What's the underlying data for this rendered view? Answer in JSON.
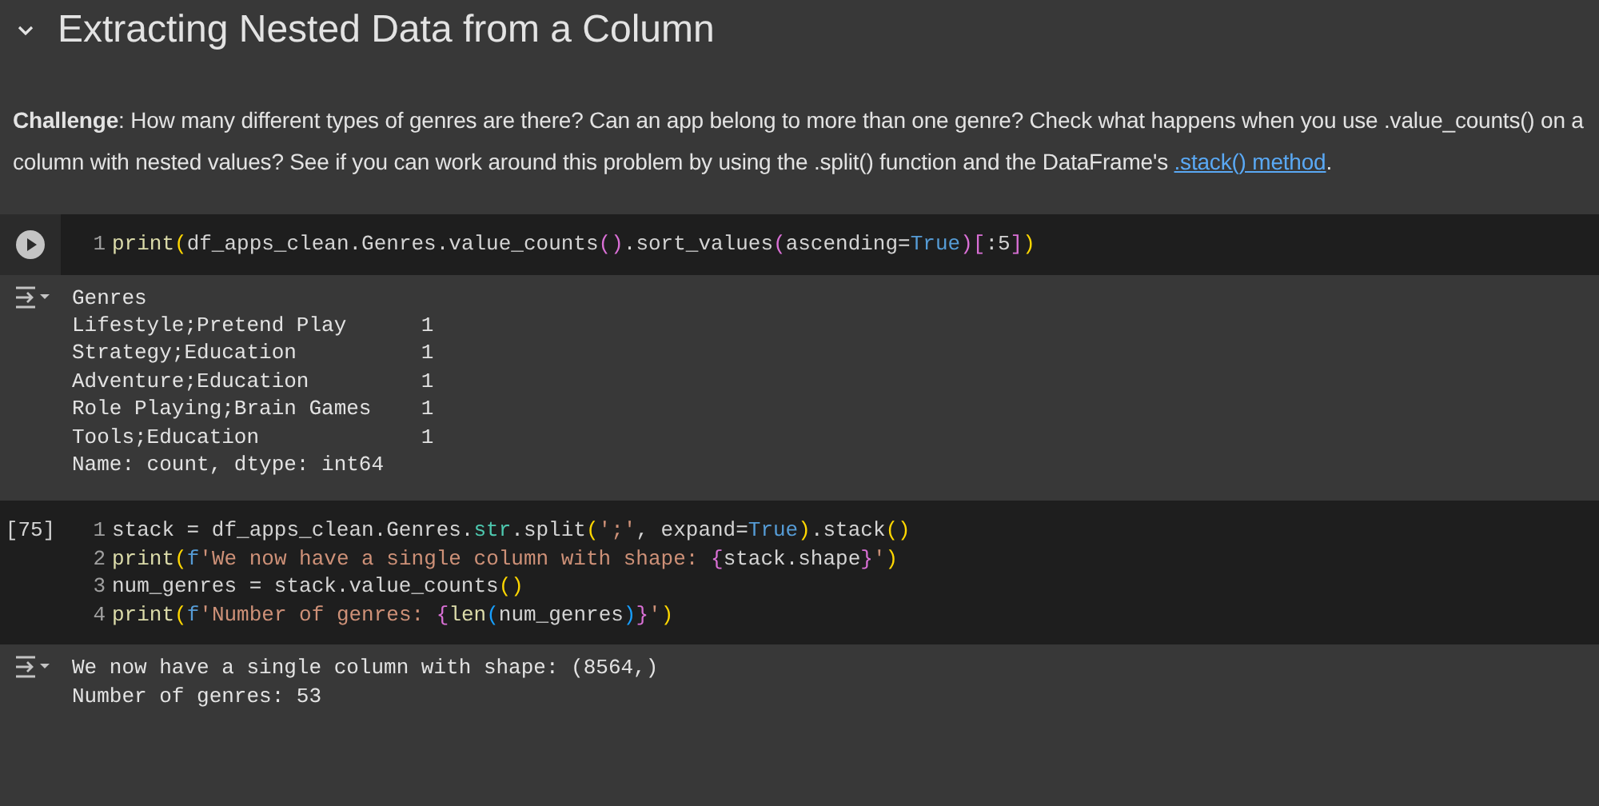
{
  "section": {
    "title": "Extracting Nested Data from a Column",
    "expanded": true
  },
  "challenge": {
    "text": "**Challenge**: How many different types of genres are there? Can an app belong to more than one genre? Check what happens when you use .value_counts() on a column with nested values? See if you can work around this problem by using the .split() function and the DataFrame's ",
    "link": ".stack() method",
    "after": "."
  },
  "cells": [
    {
      "gutter": {
        "kind": "run-button"
      },
      "lines": [
        {
          "number": "1",
          "tokens": [
            {
              "text": "print",
              "kind": "func"
            },
            {
              "text": "(",
              "kind": "paren1"
            },
            {
              "text": "df_apps_clean.Genres.value_counts",
              "kind": "plain"
            },
            {
              "text": "()",
              "kind": "paren2"
            },
            {
              "text": ".sort_values",
              "kind": "plain"
            },
            {
              "text": "(",
              "kind": "paren2"
            },
            {
              "text": "ascending=",
              "kind": "plain"
            },
            {
              "text": "True",
              "kind": "keyword"
            },
            {
              "text": ")",
              "kind": "paren2"
            },
            {
              "text": "[",
              "kind": "paren2"
            },
            {
              "text": ":5",
              "kind": "plain"
            },
            {
              "text": "]",
              "kind": "paren2"
            },
            {
              "text": ")",
              "kind": "paren1"
            }
          ]
        }
      ],
      "output": [
        "Genres",
        "Lifestyle;Pretend Play      1",
        "Strategy;Education          1",
        "Adventure;Education         1",
        "Role Playing;Brain Games    1",
        "Tools;Education             1",
        "Name: count, dtype: int64"
      ]
    },
    {
      "gutter": {
        "kind": "count",
        "text": "[75]"
      },
      "lines": [
        {
          "number": "1",
          "tokens": [
            {
              "text": "stack = df_apps_clean.Genres.",
              "kind": "plain"
            },
            {
              "text": "str",
              "kind": "type"
            },
            {
              "text": ".split",
              "kind": "plain"
            },
            {
              "text": "(",
              "kind": "paren1"
            },
            {
              "text": "';'",
              "kind": "string"
            },
            {
              "text": ", expand=",
              "kind": "plain"
            },
            {
              "text": "True",
              "kind": "keyword"
            },
            {
              "text": ")",
              "kind": "paren1"
            },
            {
              "text": ".stack",
              "kind": "plain"
            },
            {
              "text": "()",
              "kind": "paren1"
            }
          ]
        },
        {
          "number": "2",
          "tokens": [
            {
              "text": "print",
              "kind": "func"
            },
            {
              "text": "(",
              "kind": "paren1"
            },
            {
              "text": "f",
              "kind": "keyword"
            },
            {
              "text": "'We now have a single column with shape: ",
              "kind": "string"
            },
            {
              "text": "{",
              "kind": "paren2"
            },
            {
              "text": "stack.shape",
              "kind": "plain"
            },
            {
              "text": "}",
              "kind": "paren2"
            },
            {
              "text": "'",
              "kind": "string"
            },
            {
              "text": ")",
              "kind": "paren1"
            }
          ]
        },
        {
          "number": "3",
          "tokens": [
            {
              "text": "num_genres = stack.value_counts",
              "kind": "plain"
            },
            {
              "text": "()",
              "kind": "paren1"
            }
          ]
        },
        {
          "number": "4",
          "tokens": [
            {
              "text": "print",
              "kind": "func"
            },
            {
              "text": "(",
              "kind": "paren1"
            },
            {
              "text": "f",
              "kind": "keyword"
            },
            {
              "text": "'Number of genres: ",
              "kind": "string"
            },
            {
              "text": "{",
              "kind": "paren2"
            },
            {
              "text": "len",
              "kind": "func"
            },
            {
              "text": "(",
              "kind": "paren3"
            },
            {
              "text": "num_genres",
              "kind": "plain"
            },
            {
              "text": ")",
              "kind": "paren3"
            },
            {
              "text": "}",
              "kind": "paren2"
            },
            {
              "text": "'",
              "kind": "string"
            },
            {
              "text": ")",
              "kind": "paren1"
            }
          ]
        }
      ],
      "output": [
        "We now have a single column with shape: (8564,)",
        "Number of genres: 53"
      ]
    }
  ]
}
